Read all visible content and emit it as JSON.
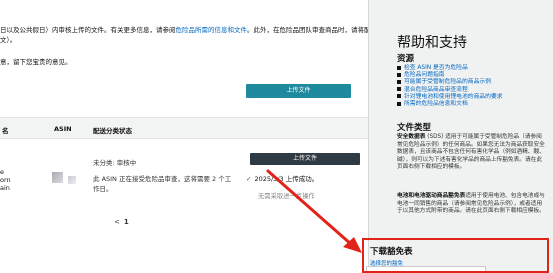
{
  "main": {
    "line1_pre": "日以及公共假日）内审核上传的文件。有关更多信息，请参阅",
    "line1_link1": "危险品所需的信息和文件",
    "line1_post": "。此外，在危险品团队审查商品时，请将配送",
    "line2": "文）。",
    "line3": "意，留下您宝贵的意见。",
    "upload_top_label": "上传文件",
    "table": {
      "headers": [
        "名",
        "ASIN",
        "配送分类状态"
      ],
      "row_text": [
        "e",
        "orn",
        "ain"
      ],
      "status_lines": [
        "未分类: 审核中",
        "此 ASIN 正在接受危险品审查，这将需要 2 个工",
        "作日。"
      ],
      "upload_label": "上传文件",
      "success_text": "2025/3/3 上传成功。",
      "success_icon": "checkmark-icon",
      "no_action": "无需采取进一步操作"
    },
    "pager": {
      "prev": "<",
      "current": "1"
    }
  },
  "panel": {
    "title": "帮助和支持",
    "resources_heading": "资源",
    "resources": [
      "检查 ASIN 是否为危险品",
      "危险品问题指南",
      "可能属于受管制危险品的商品示例",
      "混合危险品商品审查流程",
      "针对锂电池和使用锂电池的商品的要求",
      "所需的危险品信息和文档"
    ],
    "file_types_heading": "文件类型",
    "sds_bold": "安全数据表",
    "sds_text": " (SDS) 适用于可能属于受管制危险品（请参阅常见危险品示例）的任何商品。如果您无法为商品获取安全数据表，且该商品不包含任何有害化学品（例如酒精、酸、碱），则可以为下述有害化学品的商品上传豁免表。请在此页面右侧下载相应的模板。",
    "battery_bold": "电池和电池驱动商品豁免表",
    "battery_text": "适用于使用电池、包含电池或与电池一同销售的商品（请参阅常见危险品示例），或者适用于以其他方式附带的商品。请在此页面右侧下载相应模板。",
    "download_heading": "下载豁免表",
    "download_sub": "选择您的豁免"
  },
  "colors": {
    "accent_teal": "#1f8a9e",
    "dark_button": "#2f3b44",
    "link": "#0066c0",
    "highlight_red": "#e2231a"
  }
}
